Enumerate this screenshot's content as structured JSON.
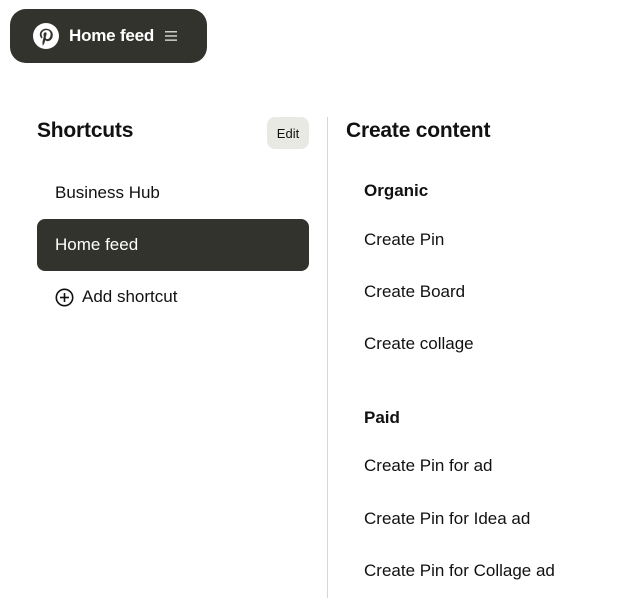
{
  "header": {
    "title": "Home feed",
    "logo_icon": "pinterest-logo-icon",
    "menu_icon": "hamburger-menu-icon"
  },
  "shortcuts": {
    "heading": "Shortcuts",
    "edit_label": "Edit",
    "items": [
      {
        "label": "Business Hub",
        "active": false
      },
      {
        "label": "Home feed",
        "active": true
      }
    ],
    "add_label": "Add shortcut",
    "add_icon": "plus-circle-icon"
  },
  "create": {
    "heading": "Create content",
    "organic": {
      "label": "Organic",
      "items": [
        "Create Pin",
        "Create Board",
        "Create collage"
      ]
    },
    "paid": {
      "label": "Paid",
      "items": [
        "Create Pin for ad",
        "Create Pin for Idea ad",
        "Create Pin for Collage ad"
      ]
    }
  },
  "colors": {
    "dark": "#33332d",
    "edit_bg": "#e9e9e4",
    "divider": "#d6d6d2"
  }
}
